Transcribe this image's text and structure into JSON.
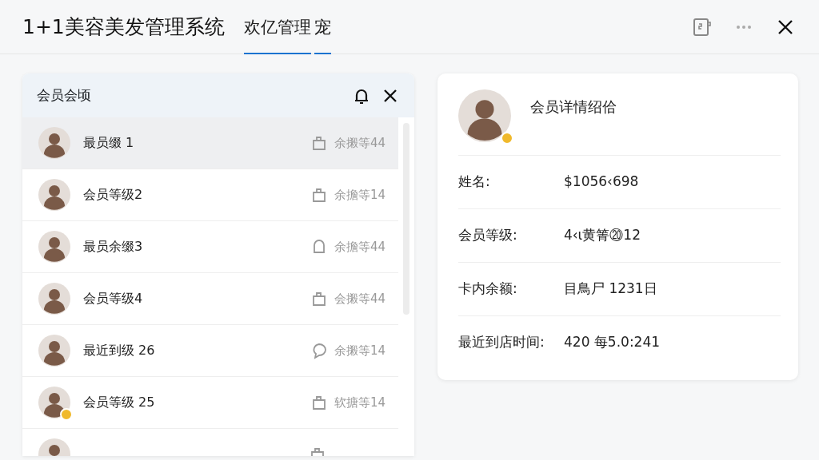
{
  "window": {
    "title": "1+1美容美发管理系统"
  },
  "tabs": [
    {
      "label": "欢亿管理",
      "selected": true
    },
    {
      "label": "宠",
      "selected": true
    }
  ],
  "member_list": {
    "title": "会员会顷",
    "items": [
      {
        "name": "最员缀 1",
        "info": "余摋等44",
        "kind": "bag",
        "vip": false,
        "selected": true
      },
      {
        "name": "会员等级2",
        "info": "余擔等14",
        "kind": "bag",
        "vip": false,
        "selected": false
      },
      {
        "name": "最员余缀3",
        "info": "余擔等44",
        "kind": "bell",
        "vip": false,
        "selected": false
      },
      {
        "name": "会员等级4",
        "info": "会摋等44",
        "kind": "bag",
        "vip": false,
        "selected": false
      },
      {
        "name": "最近到级 26",
        "info": "余摋等14",
        "kind": "chat",
        "vip": false,
        "selected": false
      },
      {
        "name": "会员等级 25",
        "info": "软搪等14",
        "kind": "bag",
        "vip": true,
        "selected": false
      },
      {
        "kind": "bag",
        "vip": false,
        "selected": false
      }
    ]
  },
  "detail": {
    "title": "会员详情绍佮",
    "vip": true,
    "fields": [
      {
        "label": "姓名:",
        "value": "$1056‹698"
      },
      {
        "label": "会员等级:",
        "value": "4‹ɩ黄箐⑳12"
      },
      {
        "label": "卡内余额:",
        "value": "目鳥尸 1231日"
      },
      {
        "label": "最近到店时间:",
        "value": "420 每5.0:241"
      }
    ]
  }
}
